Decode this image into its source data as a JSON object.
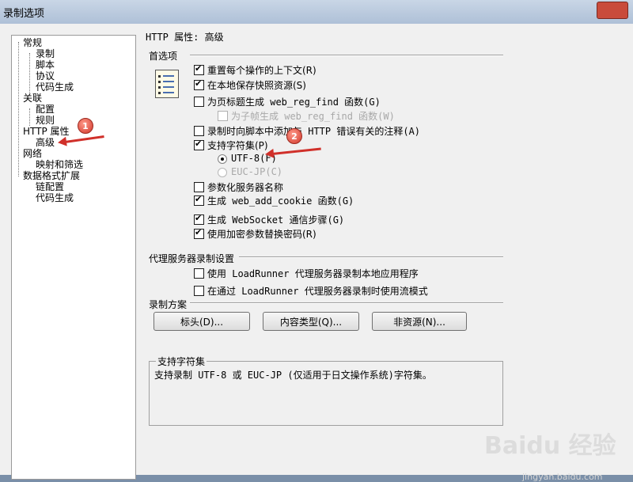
{
  "window": {
    "title": "录制选项"
  },
  "tree": {
    "items": [
      {
        "label": "常规"
      },
      {
        "label": "录制"
      },
      {
        "label": "脚本"
      },
      {
        "label": "协议"
      },
      {
        "label": "代码生成"
      },
      {
        "label": "关联"
      },
      {
        "label": "配置"
      },
      {
        "label": "规则"
      },
      {
        "label": "HTTP 属性"
      },
      {
        "label": "高级"
      },
      {
        "label": "网络"
      },
      {
        "label": "映射和筛选"
      },
      {
        "label": "数据格式扩展"
      },
      {
        "label": "链配置"
      },
      {
        "label": "代码生成"
      }
    ]
  },
  "panel": {
    "header": "HTTP 属性: 高级",
    "prefs_group": "首选项",
    "options": [
      {
        "label": "重置每个操作的上下文(R)",
        "checked": true
      },
      {
        "label": "在本地保存快照资源(S)",
        "checked": true
      },
      {
        "label": "为页标题生成 web_reg_find 函数(G)",
        "checked": false
      },
      {
        "label": "为子帧生成 web_reg_find 函数(W)",
        "checked": false,
        "disabled": true
      },
      {
        "label": "录制时向脚本中添加与 HTTP 错误有关的注释(A)",
        "checked": false
      },
      {
        "label": "支持字符集(P)",
        "checked": true
      },
      {
        "label": "UTF-8(F)",
        "selected": true
      },
      {
        "label": "EUC-JP(C)",
        "selected": false,
        "disabled": true
      },
      {
        "label": "参数化服务器名称",
        "checked": false
      },
      {
        "label": "生成 web_add_cookie 函数(G)",
        "checked": true
      },
      {
        "label": "生成 WebSocket 通信步骤(G)",
        "checked": true
      },
      {
        "label": "使用加密参数替换密码(R)",
        "checked": true
      }
    ],
    "proxy_group": "代理服务器录制设置",
    "proxy_options": [
      {
        "label": "使用 LoadRunner 代理服务器录制本地应用程序",
        "checked": false
      },
      {
        "label": "在通过 LoadRunner 代理服务器录制时使用流模式",
        "checked": false
      }
    ],
    "scheme_group": "录制方案",
    "buttons": {
      "headers": "标头(D)...",
      "content_types": "内容类型(Q)...",
      "non_resources": "非资源(N)..."
    },
    "description": {
      "title": "支持字符集",
      "text": "支持录制 UTF-8 或 EUC-JP (仅适用于日文操作系统)字符集。"
    }
  },
  "annotations": {
    "badge1": "1",
    "badge2": "2"
  },
  "watermark": {
    "brand": "Baidu 经验",
    "url": "jingyan.baidu.com"
  }
}
